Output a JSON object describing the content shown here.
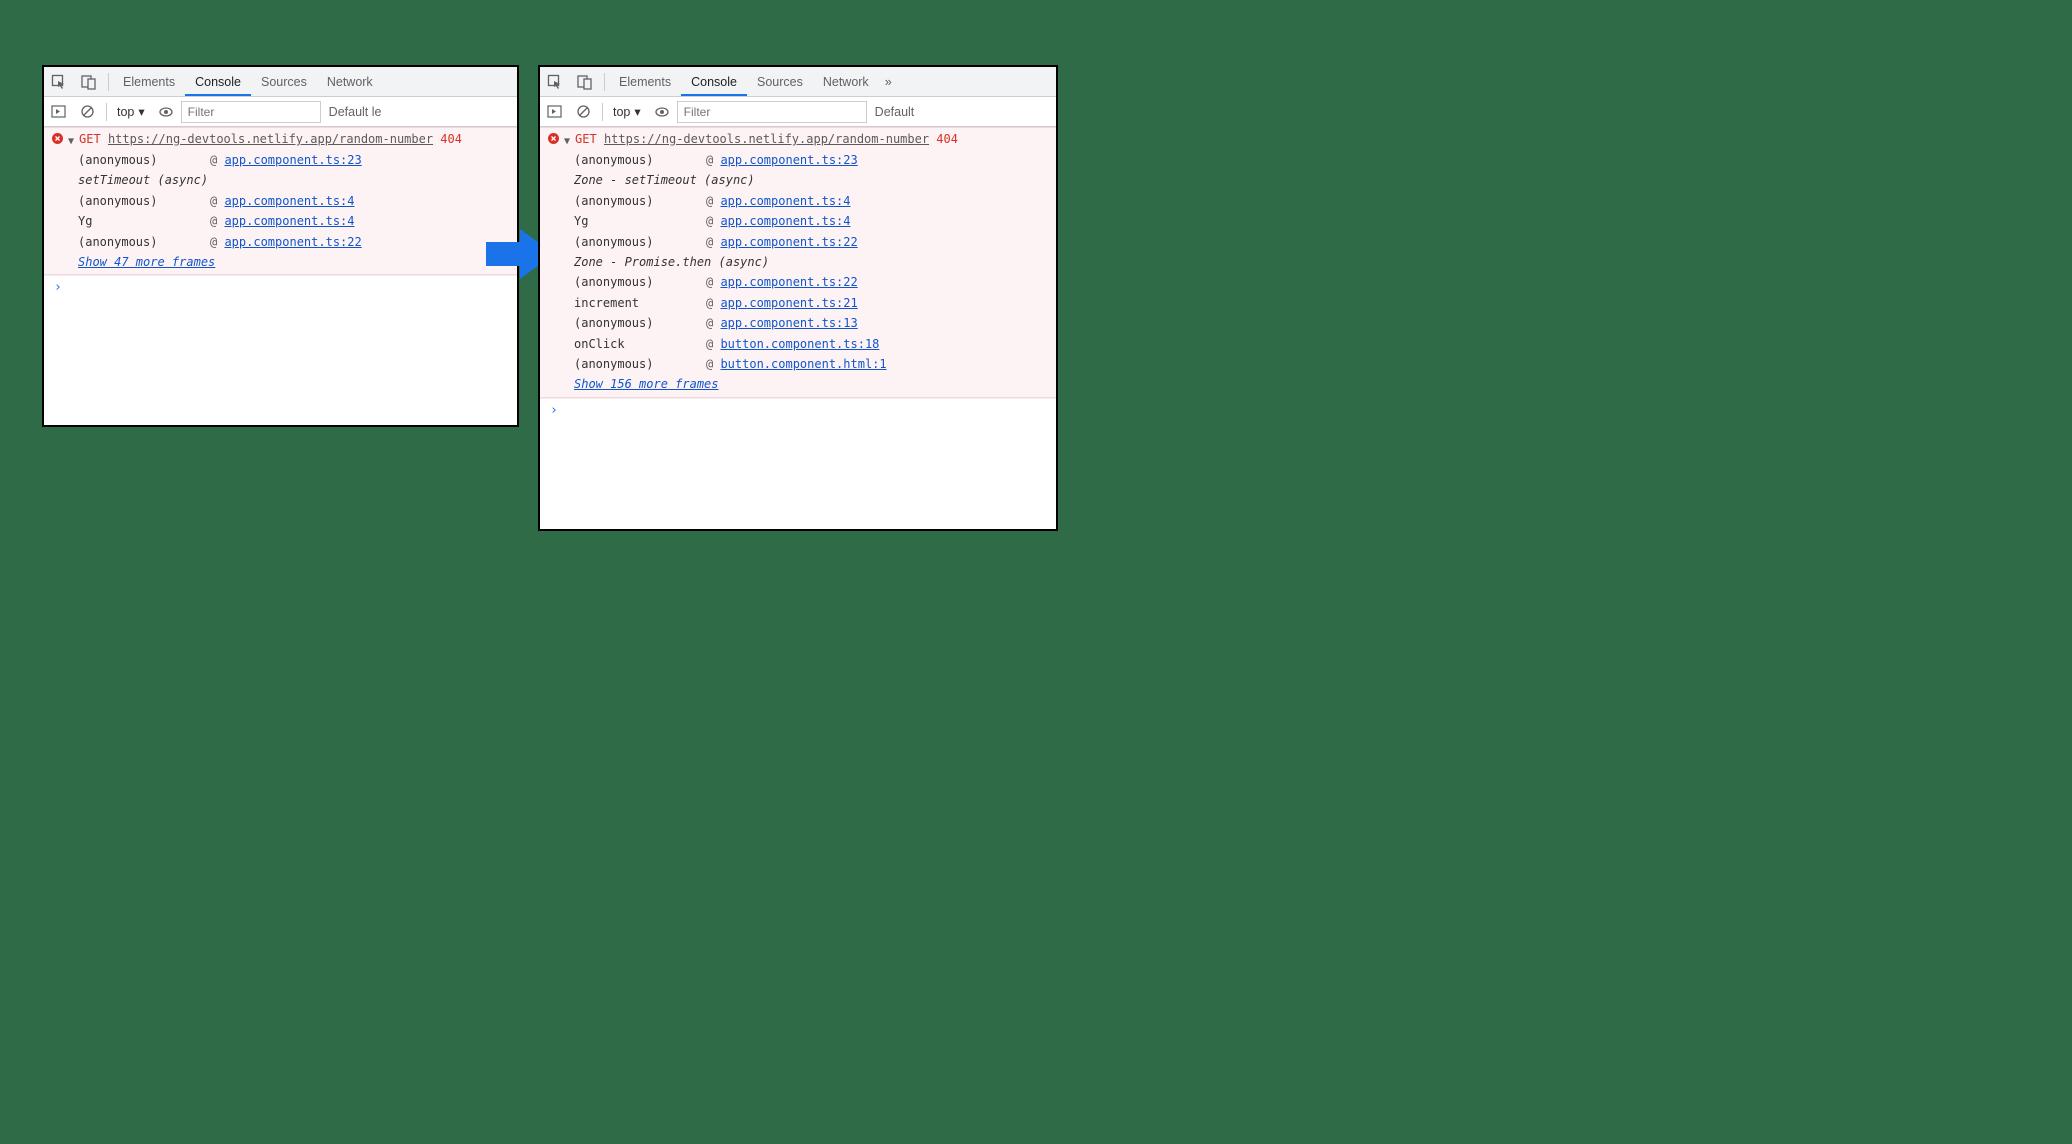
{
  "tabs": {
    "elements": "Elements",
    "console": "Console",
    "sources": "Sources",
    "network": "Network",
    "more": "»"
  },
  "toolbar": {
    "context": "top",
    "filter_placeholder": "Filter",
    "level_left": "Default le",
    "level_right": "Default"
  },
  "prompt": "›",
  "left": {
    "method": "GET",
    "url": "https://ng-devtools.netlify.app/random-number",
    "status": "404",
    "stacks": [
      {
        "type": "frame",
        "fn": "(anonymous)",
        "src": "app.component.ts:23"
      },
      {
        "type": "group",
        "label": "setTimeout (async)"
      },
      {
        "type": "frame",
        "fn": "(anonymous)",
        "src": "app.component.ts:4"
      },
      {
        "type": "frame",
        "fn": "Yg",
        "src": "app.component.ts:4"
      },
      {
        "type": "frame",
        "fn": "(anonymous)",
        "src": "app.component.ts:22"
      }
    ],
    "show_more": "Show 47 more frames"
  },
  "right": {
    "method": "GET",
    "url": "https://ng-devtools.netlify.app/random-number",
    "status": "404",
    "stacks": [
      {
        "type": "frame",
        "fn": "(anonymous)",
        "src": "app.component.ts:23"
      },
      {
        "type": "group",
        "label": "Zone - setTimeout (async)"
      },
      {
        "type": "frame",
        "fn": "(anonymous)",
        "src": "app.component.ts:4"
      },
      {
        "type": "frame",
        "fn": "Yg",
        "src": "app.component.ts:4"
      },
      {
        "type": "frame",
        "fn": "(anonymous)",
        "src": "app.component.ts:22"
      },
      {
        "type": "group",
        "label": "Zone - Promise.then (async)"
      },
      {
        "type": "frame",
        "fn": "(anonymous)",
        "src": "app.component.ts:22"
      },
      {
        "type": "frame",
        "fn": "increment",
        "src": "app.component.ts:21"
      },
      {
        "type": "frame",
        "fn": "(anonymous)",
        "src": "app.component.ts:13"
      },
      {
        "type": "frame",
        "fn": "onClick",
        "src": "button.component.ts:18"
      },
      {
        "type": "frame",
        "fn": "(anonymous)",
        "src": "button.component.html:1"
      }
    ],
    "show_more": "Show 156 more frames"
  }
}
